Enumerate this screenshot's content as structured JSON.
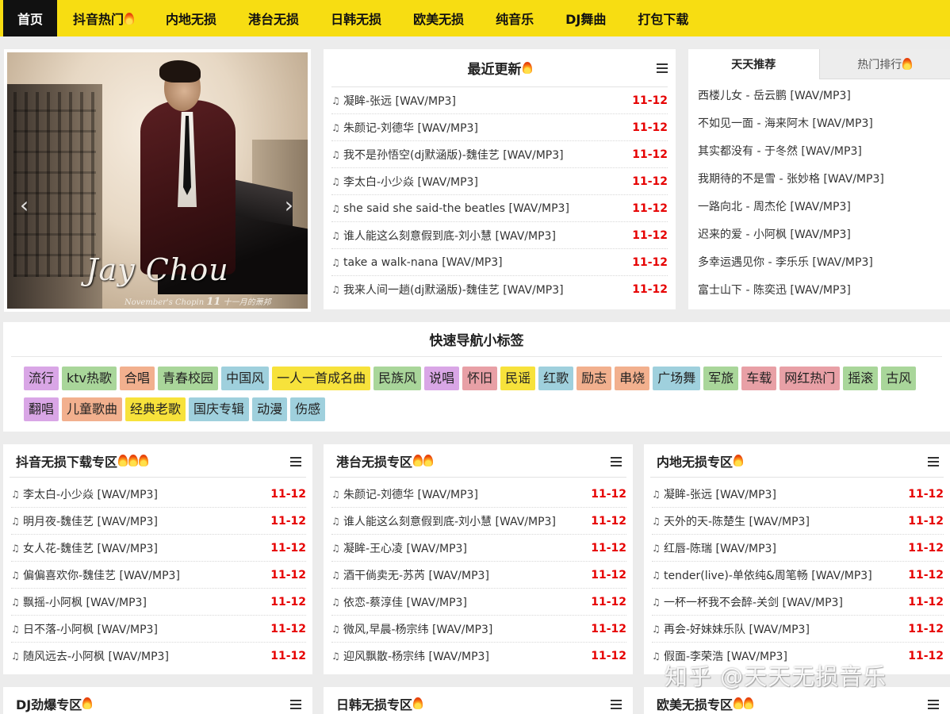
{
  "nav": {
    "items": [
      {
        "label": "首页",
        "active": true,
        "flame": false
      },
      {
        "label": "抖音热门",
        "active": false,
        "flame": true
      },
      {
        "label": "内地无损",
        "active": false,
        "flame": false
      },
      {
        "label": "港台无损",
        "active": false,
        "flame": false
      },
      {
        "label": "日韩无损",
        "active": false,
        "flame": false
      },
      {
        "label": "欧美无损",
        "active": false,
        "flame": false
      },
      {
        "label": "纯音乐",
        "active": false,
        "flame": false
      },
      {
        "label": "DJ舞曲",
        "active": false,
        "flame": false
      },
      {
        "label": "打包下载",
        "active": false,
        "flame": false
      }
    ]
  },
  "banner": {
    "cover_title": "Jay Chou",
    "cover_subtitle": "November's Chopin",
    "cover_number": "11",
    "cover_cn": "十一月的萧邦",
    "prev_arrow": "‹",
    "next_arrow": "›"
  },
  "latest": {
    "title": "最近更新",
    "rows": [
      {
        "title": "凝眸-张远 [WAV/MP3]",
        "date": "11-12"
      },
      {
        "title": "朱颜记-刘德华 [WAV/MP3]",
        "date": "11-12"
      },
      {
        "title": "我不是孙悟空(dj默涵版)-魏佳艺 [WAV/MP3]",
        "date": "11-12"
      },
      {
        "title": "李太白-小少焱 [WAV/MP3]",
        "date": "11-12"
      },
      {
        "title": "she said she said-the beatles [WAV/MP3]",
        "date": "11-12"
      },
      {
        "title": "谁人能这么刻意假到底-刘小慧 [WAV/MP3]",
        "date": "11-12"
      },
      {
        "title": "take a walk-nana [WAV/MP3]",
        "date": "11-12"
      },
      {
        "title": "我来人间一趟(dj默涵版)-魏佳艺 [WAV/MP3]",
        "date": "11-12"
      }
    ]
  },
  "recommend": {
    "tab_daily": "天天推荐",
    "tab_hot": "热门排行",
    "rows": [
      "西楼儿女 - 岳云鹏 [WAV/MP3]",
      "不如见一面 - 海来阿木 [WAV/MP3]",
      "其实都没有 - 于冬然 [WAV/MP3]",
      "我期待的不是雪 - 张妙格 [WAV/MP3]",
      "一路向北 - 周杰伦 [WAV/MP3]",
      "迟来的爱 - 小阿枫 [WAV/MP3]",
      "多幸运遇见你 - 李乐乐 [WAV/MP3]",
      "富士山下 - 陈奕迅 [WAV/MP3]"
    ]
  },
  "tags": {
    "title": "快速导航小标签",
    "items": [
      {
        "label": "流行",
        "color": "#d9a6e6"
      },
      {
        "label": "ktv热歌",
        "color": "#a9d69a"
      },
      {
        "label": "合唱",
        "color": "#f2b08e"
      },
      {
        "label": "青春校园",
        "color": "#a9d69a"
      },
      {
        "label": "中国风",
        "color": "#9fd0dd"
      },
      {
        "label": "一人一首成名曲",
        "color": "#f7e23b"
      },
      {
        "label": "民族风",
        "color": "#a9d69a"
      },
      {
        "label": "说唱",
        "color": "#d9a6e6"
      },
      {
        "label": "怀旧",
        "color": "#e8a0a6"
      },
      {
        "label": "民谣",
        "color": "#f7e23b"
      },
      {
        "label": "红歌",
        "color": "#9fd0dd"
      },
      {
        "label": "励志",
        "color": "#f2b08e"
      },
      {
        "label": "串烧",
        "color": "#f2b08e"
      },
      {
        "label": "广场舞",
        "color": "#9fd0dd"
      },
      {
        "label": "军旅",
        "color": "#a9d69a"
      },
      {
        "label": "车载",
        "color": "#e8a0a6"
      },
      {
        "label": "网红热门",
        "color": "#e8a0a6"
      },
      {
        "label": "摇滚",
        "color": "#a9d69a"
      },
      {
        "label": "古风",
        "color": "#a9d69a"
      },
      {
        "label": "翻唱",
        "color": "#d9a6e6"
      },
      {
        "label": "儿童歌曲",
        "color": "#f2b08e"
      },
      {
        "label": "经典老歌",
        "color": "#f7e23b"
      },
      {
        "label": "国庆专辑",
        "color": "#9fd0dd"
      },
      {
        "label": "动漫",
        "color": "#9fd0dd"
      },
      {
        "label": "伤感",
        "color": "#9fd0dd"
      }
    ]
  },
  "sections": [
    {
      "title": "抖音无损下载专区",
      "flames": 3,
      "rows": [
        {
          "title": "李太白-小少焱 [WAV/MP3]",
          "date": "11-12"
        },
        {
          "title": "明月夜-魏佳艺 [WAV/MP3]",
          "date": "11-12"
        },
        {
          "title": "女人花-魏佳艺 [WAV/MP3]",
          "date": "11-12"
        },
        {
          "title": "偏偏喜欢你-魏佳艺 [WAV/MP3]",
          "date": "11-12"
        },
        {
          "title": "飘摇-小阿枫 [WAV/MP3]",
          "date": "11-12"
        },
        {
          "title": "日不落-小阿枫 [WAV/MP3]",
          "date": "11-12"
        },
        {
          "title": "随风远去-小阿枫 [WAV/MP3]",
          "date": "11-12"
        }
      ]
    },
    {
      "title": "港台无损专区",
      "flames": 2,
      "rows": [
        {
          "title": "朱颜记-刘德华 [WAV/MP3]",
          "date": "11-12"
        },
        {
          "title": "谁人能这么刻意假到底-刘小慧 [WAV/MP3]",
          "date": "11-12"
        },
        {
          "title": "凝眸-王心凌 [WAV/MP3]",
          "date": "11-12"
        },
        {
          "title": "酒干倘卖无-苏芮 [WAV/MP3]",
          "date": "11-12"
        },
        {
          "title": "依恋-蔡淳佳 [WAV/MP3]",
          "date": "11-12"
        },
        {
          "title": "微风,早晨-杨宗纬 [WAV/MP3]",
          "date": "11-12"
        },
        {
          "title": "迎风飘散-杨宗纬 [WAV/MP3]",
          "date": "11-12"
        }
      ]
    },
    {
      "title": "内地无损专区",
      "flames": 1,
      "rows": [
        {
          "title": "凝眸-张远 [WAV/MP3]",
          "date": "11-12"
        },
        {
          "title": "天外的天-陈楚生 [WAV/MP3]",
          "date": "11-12"
        },
        {
          "title": "红唇-陈瑞 [WAV/MP3]",
          "date": "11-12"
        },
        {
          "title": "tender(live)-单依纯&周笔畅 [WAV/MP3]",
          "date": "11-12"
        },
        {
          "title": "一杯一杯我不会醉-关剑 [WAV/MP3]",
          "date": "11-12"
        },
        {
          "title": "再会-好妹妹乐队 [WAV/MP3]",
          "date": "11-12"
        },
        {
          "title": "假面-李荣浩 [WAV/MP3]",
          "date": "11-12"
        }
      ]
    },
    {
      "title": "DJ劲爆专区",
      "flames": 1,
      "rows": []
    },
    {
      "title": "日韩无损专区",
      "flames": 1,
      "rows": []
    },
    {
      "title": "欧美无损专区",
      "flames": 2,
      "rows": []
    }
  ],
  "watermark": "知乎 @天天无损音乐",
  "colors": {
    "nav_bg": "#f7dd12",
    "date_red": "#e60000",
    "page_bg": "#ececec"
  }
}
